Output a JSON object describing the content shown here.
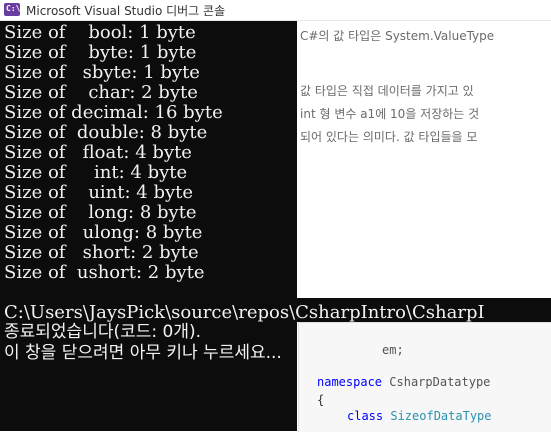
{
  "window": {
    "icon_label": "C:\\",
    "title": "Microsoft Visual Studio 디버그 콘솔"
  },
  "console": {
    "size_lines": [
      "Size of    bool: 1 byte",
      "Size of    byte: 1 byte",
      "Size of   sbyte: 1 byte",
      "Size of    char: 2 byte",
      "Size of decimal: 16 byte",
      "Size of  double: 8 byte",
      "Size of   float: 4 byte",
      "Size of     int: 4 byte",
      "Size of    uint: 4 byte",
      "Size of    long: 8 byte",
      "Size of   ulong: 8 byte",
      "Size of   short: 2 byte",
      "Size of  ushort: 2 byte"
    ],
    "path_line": "C:\\Users\\JaysPick\\source\\repos\\CsharpIntro\\CsharpI",
    "exit_message": "종료되었습니다(코드: 0개).",
    "close_prompt": "이 창을 닫으려면 아무 키나 누르세요..."
  },
  "background_blog": {
    "heading": "C#의 값 타입은 System.ValueType",
    "para1": "값 타입은 직접 데이터를 가지고 있",
    "para2": "int 형 변수 a1에 10을 저장하는 것",
    "para3": "되어 있다는 의미다. 값 타입들을 모",
    "code_using": "em;",
    "code_namespace_kw": "namespace",
    "code_namespace_name": "CsharpDatatype",
    "code_brace": "{",
    "code_class_kw": "class",
    "code_class_name": "SizeofDataType"
  },
  "colors": {
    "console_bg": "#0c0c0c",
    "console_text": "#f2f2f2",
    "keyword": "#0000ff",
    "type_name": "#2b91af"
  }
}
